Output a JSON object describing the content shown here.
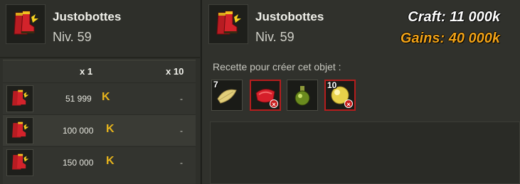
{
  "left_panel": {
    "item": {
      "name": "Justobottes",
      "level": "Niv. 59",
      "icon": "boots-icon"
    },
    "table": {
      "col_x1": "x 1",
      "col_x10": "x 10",
      "rows": [
        {
          "price": "51 999",
          "currency_icon": "kama-icon",
          "currency_glyph": "K",
          "x10": "-"
        },
        {
          "price": "100 000",
          "currency_icon": "kama-icon",
          "currency_glyph": "K",
          "x10": "-"
        },
        {
          "price": "150 000",
          "currency_icon": "kama-icon",
          "currency_glyph": "K",
          "x10": "-"
        }
      ]
    }
  },
  "right_panel": {
    "item": {
      "name": "Justobottes",
      "level": "Niv. 59",
      "icon": "boots-icon"
    },
    "recipe_label": "Recette pour créer cet objet :",
    "ingredients": [
      {
        "qty": "7",
        "icon": "feather-icon",
        "missing": false
      },
      {
        "qty": "",
        "icon": "red-fabric-icon",
        "missing": true,
        "badge": "×"
      },
      {
        "qty": "",
        "icon": "potion-icon",
        "missing": false
      },
      {
        "qty": "10",
        "icon": "gold-orb-icon",
        "missing": true,
        "badge": "×"
      }
    ]
  },
  "overlay": {
    "craft": "Craft: 11 000k",
    "gains": "Gains: 40 000k"
  },
  "colors": {
    "accent_gold": "#e7b41c",
    "gains_orange": "#f2a318",
    "missing_red": "#b41d1d"
  }
}
